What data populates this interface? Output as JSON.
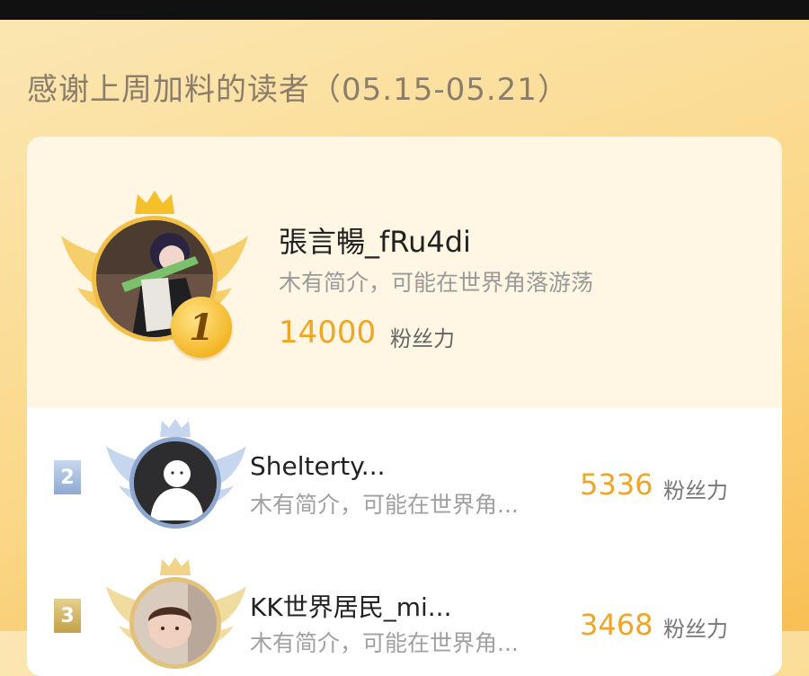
{
  "header": {
    "title": "感谢上周加料的读者（05.15-05.21）"
  },
  "top_reader": {
    "rank": "1",
    "name": "張言暢_fRu4di",
    "bio": "木有简介，可能在世界角落游荡",
    "score": "14000",
    "unit": "粉丝力"
  },
  "readers": [
    {
      "rank": "2",
      "name": "Shelterty...",
      "bio": "木有简介，可能在世界角...",
      "score": "5336",
      "unit": "粉丝力"
    },
    {
      "rank": "3",
      "name": "KK世界居民_mi...",
      "bio": "木有简介，可能在世界角...",
      "score": "3468",
      "unit": "粉丝力"
    }
  ],
  "colors": {
    "gold": "#f2be46",
    "silver": "#8ea7cf",
    "bronze": "#e2c27a",
    "score": "#f0a524"
  }
}
